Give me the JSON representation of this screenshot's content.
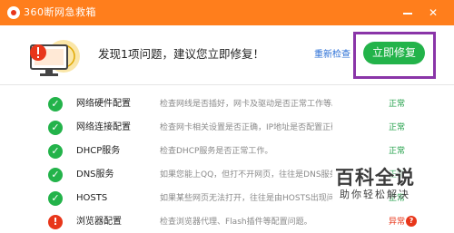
{
  "window": {
    "title": "360断网急救箱",
    "minimize_icon": "minimize-icon",
    "close_icon": "close-icon",
    "brand_color": "#ff7e1c"
  },
  "header": {
    "message": "发现1项问题，建议您立即修复！",
    "recheck_label": "重新检查",
    "fix_label": "立即修复",
    "icon": "monitor-warning-icon",
    "highlight_color": "#8a35a8"
  },
  "rows": [
    {
      "name": "网络硬件配置",
      "desc": "检查网线是否插好，网卡及驱动是否正常工作等。",
      "status": "正常",
      "state": "ok"
    },
    {
      "name": "网络连接配置",
      "desc": "检查网卡相关设置是否正确，IP地址是否配置正确。",
      "status": "正常",
      "state": "ok"
    },
    {
      "name": "DHCP服务",
      "desc": "检查DHCP服务是否正常工作。",
      "status": "正常",
      "state": "ok"
    },
    {
      "name": "DNS服务",
      "desc": "如果您能上QQ，但打不开网页，往往是DNS服务问题。",
      "status": "正常",
      "state": "ok"
    },
    {
      "name": "HOSTS",
      "desc": "如果某些网页无法打开，往往是由HOSTS出现问题。",
      "status": "正常",
      "state": "ok"
    },
    {
      "name": "浏览器配置",
      "desc": "检查浏览器代理、Flash插件等配置问题。",
      "status": "异常",
      "state": "bad"
    }
  ],
  "colors": {
    "ok": "#23b34a",
    "bad": "#e8361a",
    "link": "#2a6fd6"
  },
  "watermark": {
    "title": "百科全说",
    "subtitle": "助你轻松解决"
  }
}
